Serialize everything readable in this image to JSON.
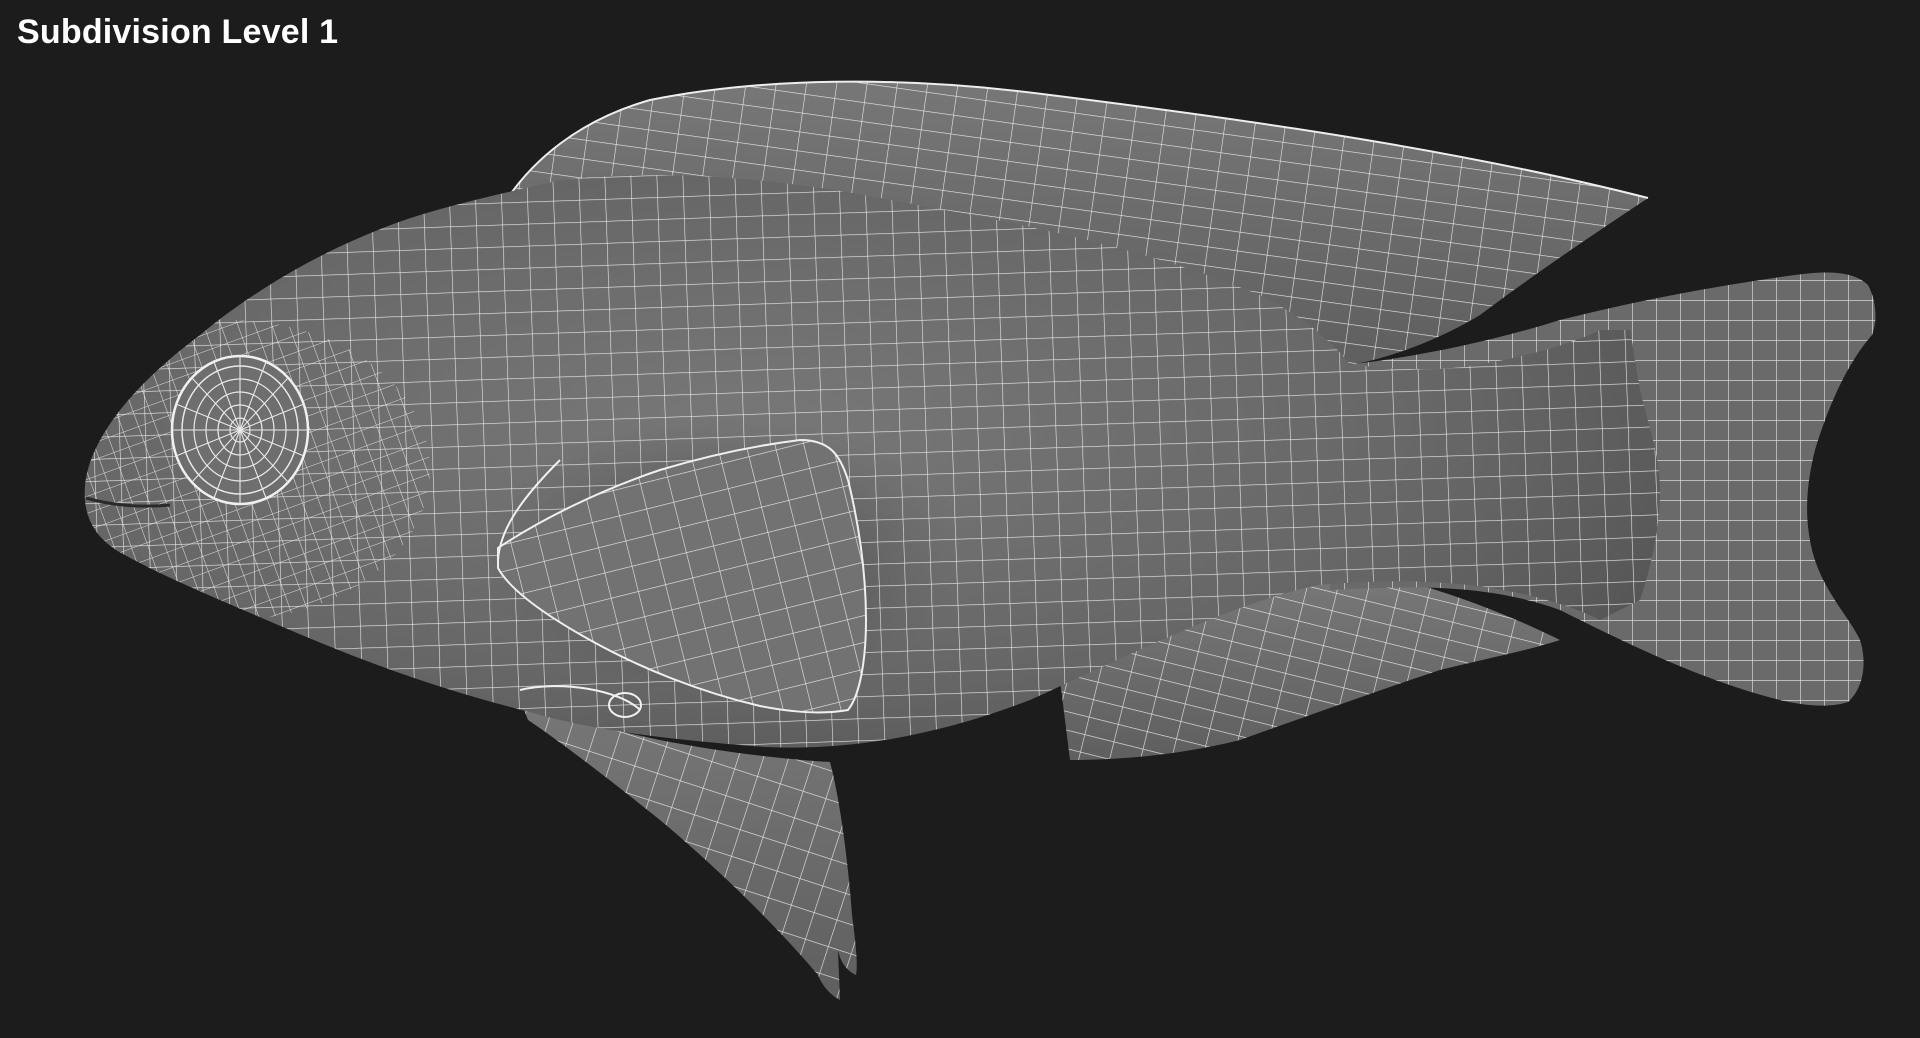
{
  "viewport": {
    "caption": "Subdivision Level 1"
  },
  "colors": {
    "background": "#1c1c1c",
    "mesh_surface": "#6c6c6c",
    "wireframe": "#e8e8e8"
  },
  "subject": {
    "icon": "fish-wireframe-icon"
  }
}
